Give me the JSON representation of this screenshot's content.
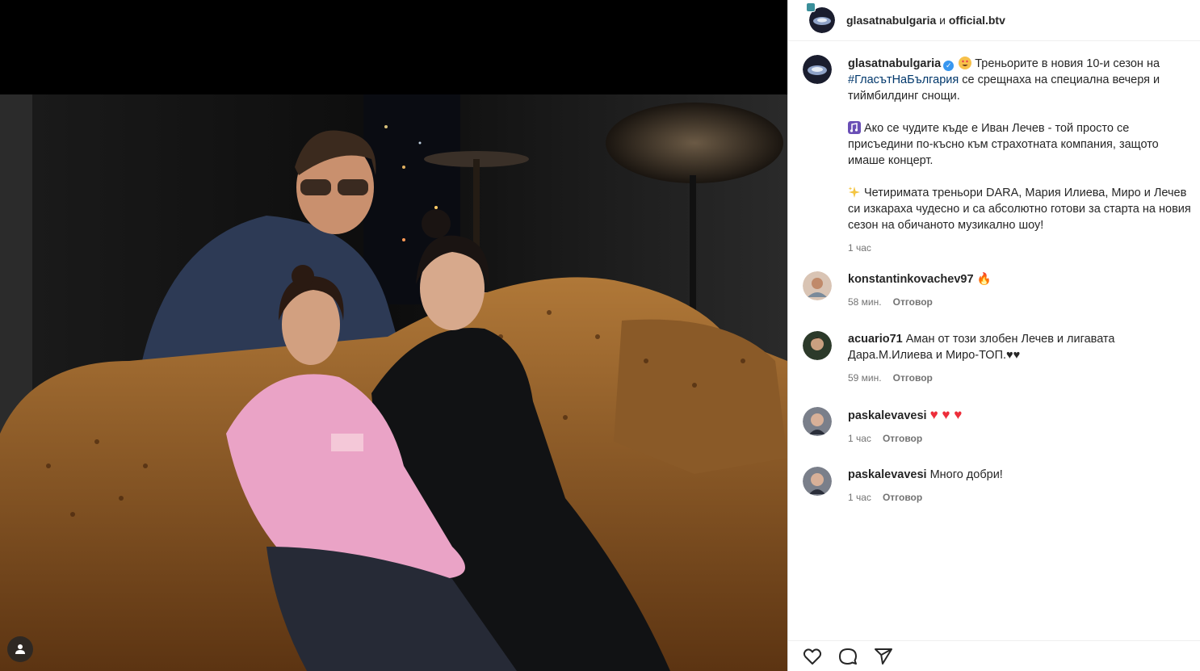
{
  "header": {
    "account": "glasatnabulgaria",
    "conjunction": "и",
    "collaborator": "official.btv"
  },
  "caption": {
    "username": "glasatnabulgaria",
    "verified_symbol": "✓",
    "line1_pre": "Треньорите в новия 10-и сезон на",
    "hashtag": "#ГласътНаБългария",
    "line1_post": "се срещнаха на специална вечеря и тиймбилдинг снощи.",
    "para2": "Ако се чудите къде е Иван Лечев - той просто се присъедини по-късно към страхотната компания, защото имаше концерт.",
    "para3": "Четиримата треньори DARA, Мария Илиева, Миро и Лечев си изкараха чудесно и са абсолютно готови за старта на новия сезон на обичаното музикално шоу!",
    "time": "1 час"
  },
  "comments": [
    {
      "username": "konstantinkovachev97",
      "text": "🔥",
      "time": "58 мин.",
      "reply": "Отговор"
    },
    {
      "username": "acuario71",
      "text": "Аман от този злобен Лечев и лигавата Дара.М.Илиева и Миро-ТОП.♥♥",
      "time": "59 мин.",
      "reply": "Отговор"
    },
    {
      "username": "paskalevavesi",
      "text": "♥ ♥ ♥",
      "time": "1 час",
      "reply": "Отговор"
    },
    {
      "username": "paskalevavesi",
      "text": "Много добри!",
      "time": "1 час",
      "reply": "Отговор"
    }
  ],
  "icons": {
    "like": "heart-icon",
    "comment": "comment-icon",
    "share": "share-icon",
    "tagged": "user-tag-icon",
    "emoji_eyes": "heart-eyes-emoji",
    "emoji_music": "music-notes-emoji",
    "emoji_sparkles": "sparkles-emoji"
  },
  "colors": {
    "link": "#00376b",
    "verified": "#3897f0",
    "heart": "#ed2d3a",
    "secondary_text": "#737373"
  }
}
